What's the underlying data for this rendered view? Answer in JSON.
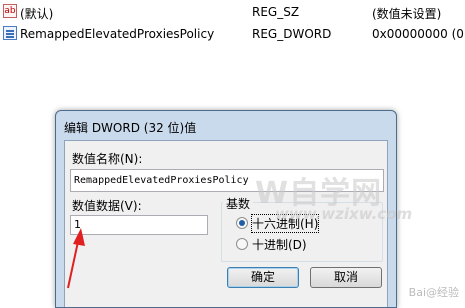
{
  "registry_list": {
    "rows": [
      {
        "icon": "string-value-icon",
        "icon_text": "ab",
        "name": "(默认)",
        "type": "REG_SZ",
        "data": "(数值未设置)"
      },
      {
        "icon": "binary-value-icon",
        "name": "RemappedElevatedProxiesPolicy",
        "type": "REG_DWORD",
        "data": "0x00000000 (0)"
      }
    ]
  },
  "dialog": {
    "title": "编辑 DWORD (32 位)值",
    "value_name_label": "数值名称(N):",
    "value_name": "RemappedElevatedProxiesPolicy",
    "value_data_label": "数值数据(V):",
    "value_data": "1",
    "base_label": "基数",
    "base_options": [
      {
        "label": "十六进制(H)",
        "checked": true
      },
      {
        "label": "十进制(D)",
        "checked": false
      }
    ],
    "ok_label": "确定",
    "cancel_label": "取消"
  },
  "overlays": {
    "watermark": "W自学网",
    "watermark_url": "www.wzixw.com",
    "corner_text": "Bai@经验",
    "arrow_color": "#e02020"
  }
}
